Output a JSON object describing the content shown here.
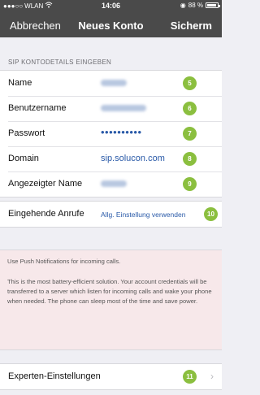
{
  "status_bar": {
    "carrier": "WLAN",
    "time": "14:06",
    "battery": "88 %"
  },
  "nav": {
    "cancel": "Abbrechen",
    "title": "Neues Konto",
    "save": "Sicherm"
  },
  "section_header": "SIP KONTODETAILS EINGEBEN",
  "account_rows": [
    {
      "label": "Name",
      "badge": "5"
    },
    {
      "label": "Benutzername",
      "badge": "6"
    },
    {
      "label": "Passwort",
      "value": "••••••••••",
      "badge": "7"
    },
    {
      "label": "Domain",
      "value": "sip.solucon.com",
      "badge": "8"
    },
    {
      "label": "Angezeigter Name",
      "badge": "9"
    }
  ],
  "incoming": {
    "label": "Eingehende Anrufe",
    "value": "Allg. Einstellung verwenden",
    "badge": "10"
  },
  "info_text_1": "Use Push Notifications for incoming calls.",
  "info_text_2": "This is the most battery-efficient solution. Your account credentials will be transferred to a server which listen for incoming calls and wake your phone when needed. The phone can sleep most of the time and save power.",
  "expert": {
    "label": "Experten-Einstellungen",
    "badge": "11"
  },
  "colors": {
    "nav_bg": "#4a4a4a",
    "accent": "#2a5aa8",
    "badge": "#8bbf3f",
    "info_bg": "#f7e8ea"
  }
}
